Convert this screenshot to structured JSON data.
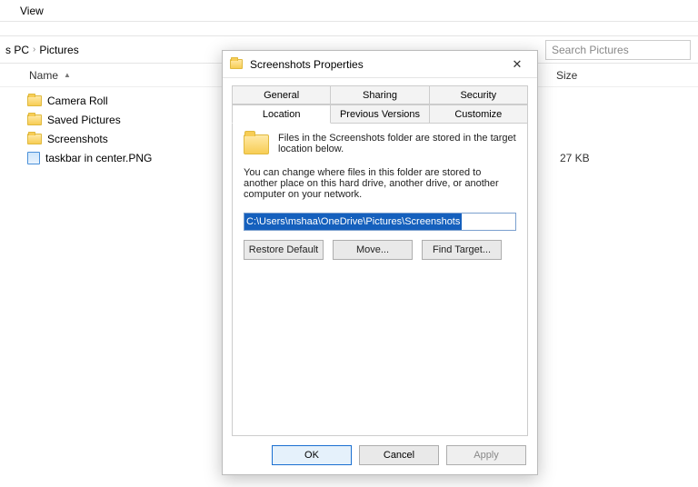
{
  "explorer": {
    "view_label": "View",
    "breadcrumb": {
      "part1": "s PC",
      "part2": "Pictures"
    },
    "search_placeholder": "Search Pictures",
    "headers": {
      "name": "Name",
      "size": "Size"
    },
    "items": {
      "0": {
        "label": "Camera Roll"
      },
      "1": {
        "label": "Saved Pictures"
      },
      "2": {
        "label": "Screenshots"
      },
      "3": {
        "label": "taskbar in center.PNG",
        "size": "27 KB"
      }
    }
  },
  "dialog": {
    "title": "Screenshots Properties",
    "tabs": {
      "general": "General",
      "sharing": "Sharing",
      "security": "Security",
      "location": "Location",
      "previous": "Previous Versions",
      "customize": "Customize"
    },
    "body": {
      "line1": "Files in the Screenshots folder are stored in the target location below.",
      "line2": "You can change where files in this folder are stored to another place on this hard drive, another drive, or another computer on your network.",
      "path": "C:\\Users\\mshaa\\OneDrive\\Pictures\\Screenshots"
    },
    "buttons": {
      "restore": "Restore Default",
      "move": "Move...",
      "find": "Find Target...",
      "ok": "OK",
      "cancel": "Cancel",
      "apply": "Apply"
    }
  }
}
